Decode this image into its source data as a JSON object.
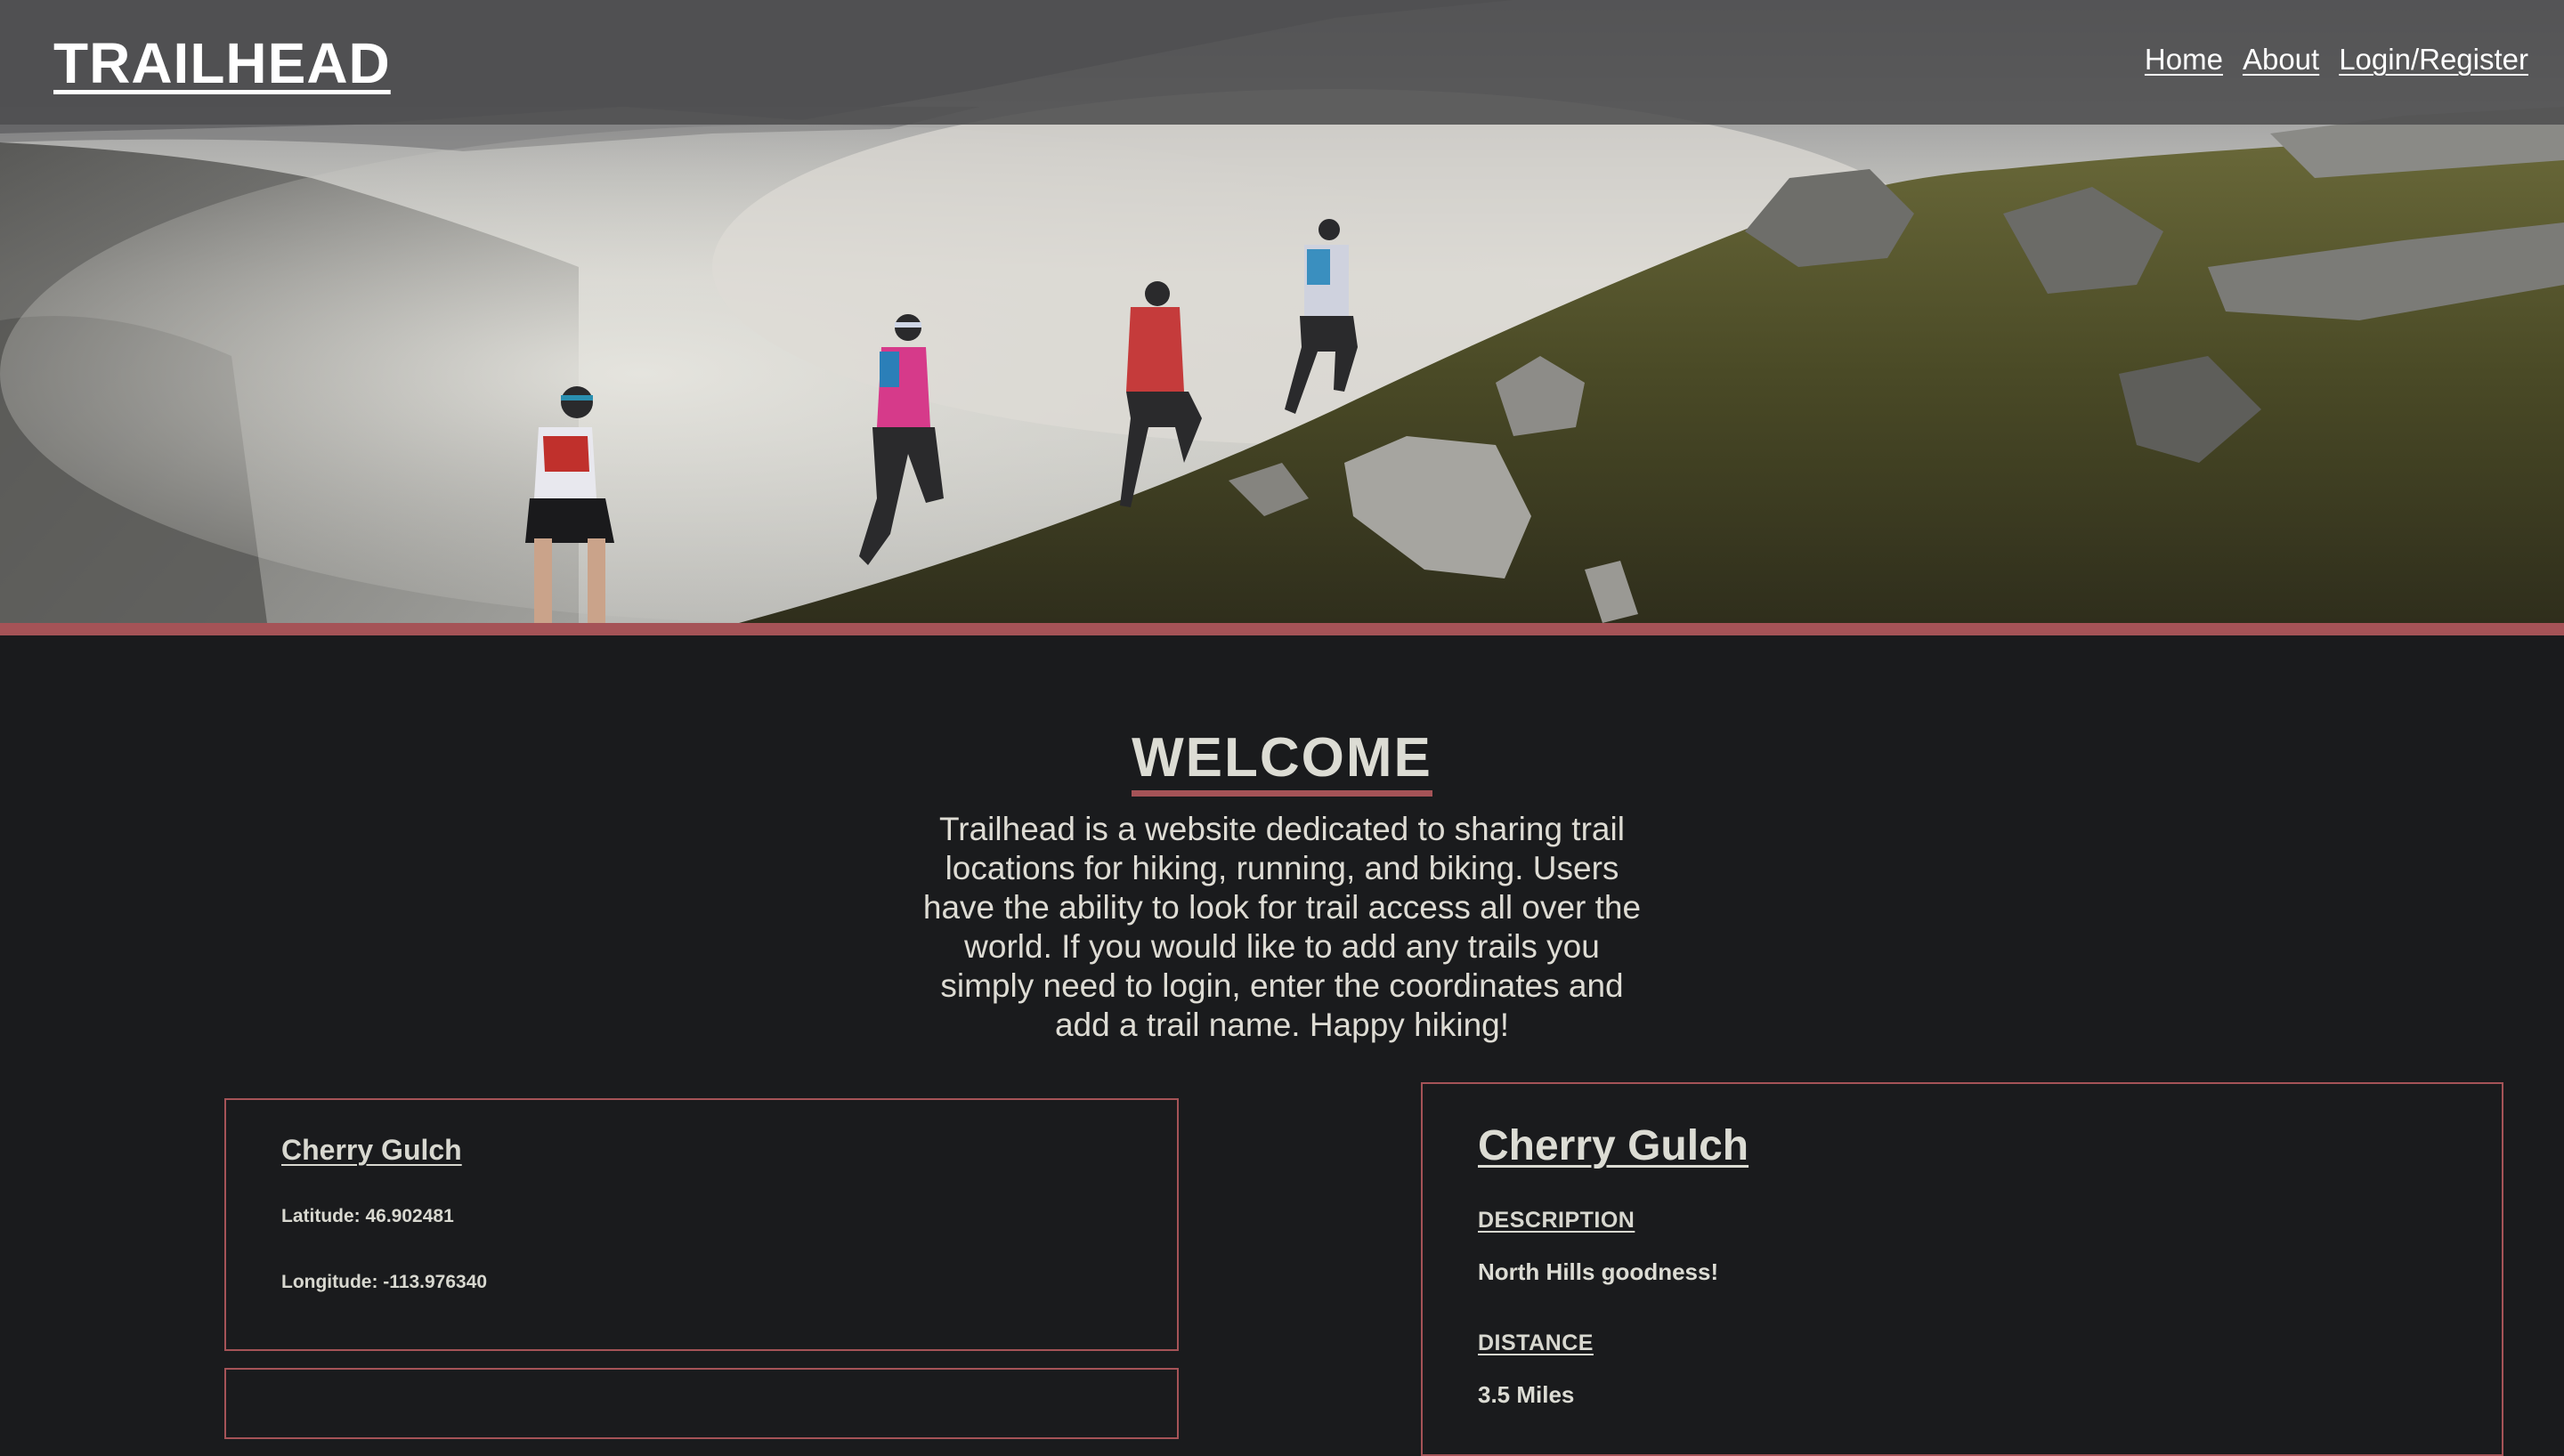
{
  "nav": {
    "brand": "TRAILHEAD",
    "links": [
      {
        "label": "Home"
      },
      {
        "label": "About"
      },
      {
        "label": "Login/Register"
      }
    ]
  },
  "hero": {
    "image": "trail-runners-mountain-ridge-photo",
    "accent_color": "#a55357"
  },
  "welcome": {
    "title": "WELCOME",
    "text": "Trailhead is a website dedicated to sharing trail locations for hiking, running, and biking. Users have the ability to look for trail access all over the world. If you would like to add any trails you simply need to login, enter the coordinates and add a trail name. Happy hiking!"
  },
  "trails": [
    {
      "name": "Cherry Gulch",
      "latitude_label": "Latitude: 46.902481",
      "longitude_label": "Longitude: -113.976340"
    }
  ],
  "detail": {
    "name": "Cherry Gulch",
    "description_label": "DESCRIPTION",
    "description": "North Hills goodness!",
    "distance_label": "DISTANCE",
    "distance": "3.5 Miles"
  },
  "colors": {
    "background": "#1a1b1d",
    "accent": "#a55357",
    "navbar": "#4e4e50",
    "text": "#d8d8d0"
  }
}
